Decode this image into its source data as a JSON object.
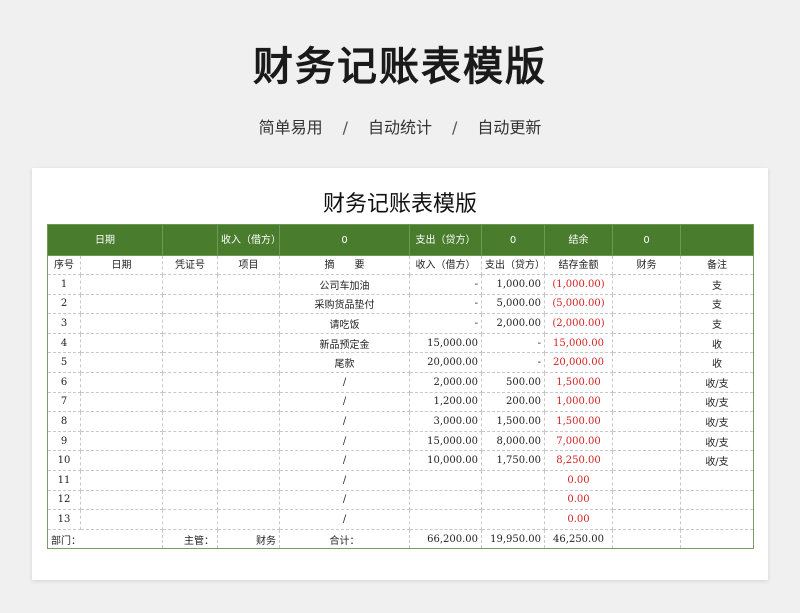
{
  "header": {
    "title": "财务记账表模版",
    "features": [
      "简单易用",
      "自动统计",
      "自动更新"
    ],
    "separator": "/"
  },
  "sheet": {
    "title": "财务记账表模版",
    "summary": {
      "date_label": "日期",
      "income_label": "收入（借方）",
      "income_value": "0",
      "expense_label": "支出（贷方）",
      "expense_value": "0",
      "balance_label": "结余",
      "balance_value": "0"
    },
    "columns": [
      "序号",
      "日期",
      "凭证号",
      "项目",
      "摘　　要",
      "收入（借方）",
      "支出（贷方）",
      "结存金额",
      "财务",
      "备注"
    ],
    "rows": [
      {
        "no": "1",
        "summary": "公司车加油",
        "income": "-",
        "expense": "1,000.00",
        "balance": "(1,000.00)",
        "finance": "",
        "note": "支"
      },
      {
        "no": "2",
        "summary": "采购货品垫付",
        "income": "-",
        "expense": "5,000.00",
        "balance": "(5,000.00)",
        "finance": "",
        "note": "支"
      },
      {
        "no": "3",
        "summary": "请吃饭",
        "income": "-",
        "expense": "2,000.00",
        "balance": "(2,000.00)",
        "finance": "",
        "note": "支"
      },
      {
        "no": "4",
        "summary": "新品预定金",
        "income": "15,000.00",
        "expense": "-",
        "balance": "15,000.00",
        "finance": "",
        "note": "收"
      },
      {
        "no": "5",
        "summary": "尾款",
        "income": "20,000.00",
        "expense": "-",
        "balance": "20,000.00",
        "finance": "",
        "note": "收"
      },
      {
        "no": "6",
        "summary": "/",
        "income": "2,000.00",
        "expense": "500.00",
        "balance": "1,500.00",
        "finance": "",
        "note": "收/支"
      },
      {
        "no": "7",
        "summary": "/",
        "income": "1,200.00",
        "expense": "200.00",
        "balance": "1,000.00",
        "finance": "",
        "note": "收/支"
      },
      {
        "no": "8",
        "summary": "/",
        "income": "3,000.00",
        "expense": "1,500.00",
        "balance": "1,500.00",
        "finance": "",
        "note": "收/支"
      },
      {
        "no": "9",
        "summary": "/",
        "income": "15,000.00",
        "expense": "8,000.00",
        "balance": "7,000.00",
        "finance": "",
        "note": "收/支"
      },
      {
        "no": "10",
        "summary": "/",
        "income": "10,000.00",
        "expense": "1,750.00",
        "balance": "8,250.00",
        "finance": "",
        "note": "收/支"
      },
      {
        "no": "11",
        "summary": "/",
        "income": "",
        "expense": "",
        "balance": "0.00",
        "finance": "",
        "note": ""
      },
      {
        "no": "12",
        "summary": "/",
        "income": "",
        "expense": "",
        "balance": "0.00",
        "finance": "",
        "note": ""
      },
      {
        "no": "13",
        "summary": "/",
        "income": "",
        "expense": "",
        "balance": "0.00",
        "finance": "",
        "note": ""
      }
    ],
    "footer": {
      "dept_label": "部门：",
      "supervisor_label": "主管：",
      "finance_label": "财务",
      "total_label": "合计：",
      "total_income": "66,200.00",
      "total_expense": "19,950.00",
      "total_balance": "46,250.00"
    },
    "colors": {
      "header_green": "#4a7c2e",
      "negative_red": "#d42020"
    }
  }
}
